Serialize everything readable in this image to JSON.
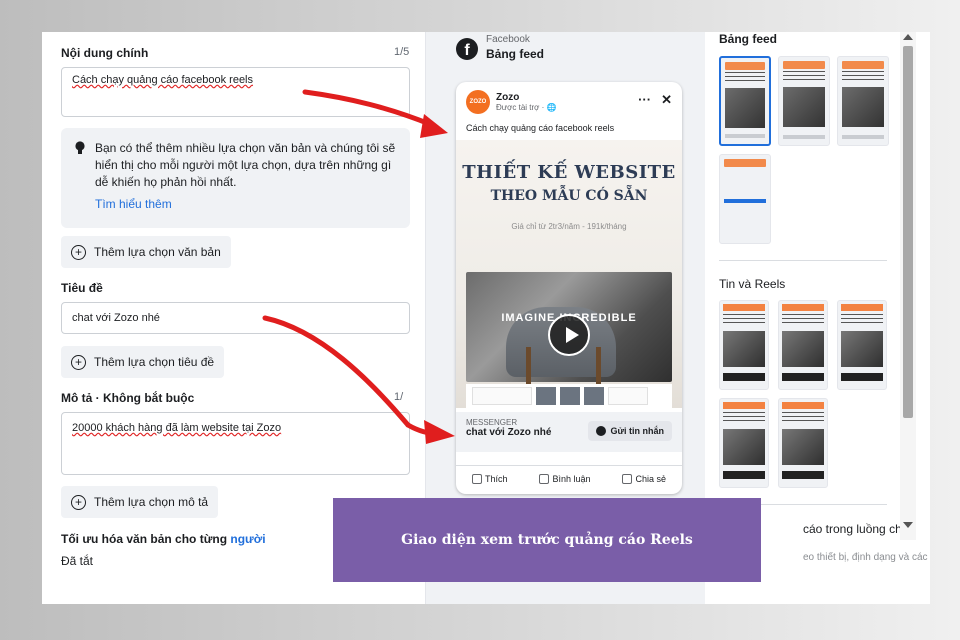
{
  "left": {
    "main_content": {
      "label": "Nội dung chính",
      "count": "1/5",
      "value": "Cách chạy quảng cáo facebook reels"
    },
    "tip": {
      "text": "Bạn có thể thêm nhiều lựa chọn văn bản và chúng tôi sẽ hiển thị cho mỗi người một lựa chọn, dựa trên những gì dễ khiến họ phản hồi nhất.",
      "link": "Tìm hiểu thêm"
    },
    "add_text_button": "Thêm lựa chọn văn bản",
    "title_section": {
      "label": "Tiêu đề",
      "value": "chat với Zozo nhé"
    },
    "add_title_button": "Thêm lựa chọn tiêu đề",
    "desc_section": {
      "label": "Mô tả · Không bắt buộc",
      "count": "1/",
      "value": "20000 khách hàng đã làm website tại Zozo"
    },
    "add_desc_button": "Thêm lựa chọn mô tả",
    "optimize": {
      "label_prefix": "Tối ưu hóa văn bản cho từng ",
      "label_highlight": "người",
      "status": "Đã tắt"
    }
  },
  "preview": {
    "platform": "Facebook",
    "placement": "Bảng feed",
    "page_name": "Zozo",
    "sponsored": "Được tài trợ · ",
    "caption": "Cách chạy quảng cáo facebook reels",
    "headline1": "THIẾT KẾ WEBSITE",
    "headline2": "THEO MẪU CÓ SẴN",
    "subline": "Giá chỉ từ 2tr3/năm - 191k/tháng",
    "imagine": "IMAGINE INCREDIBLE",
    "cta_small": "MESSENGER",
    "cta_title": "chat với Zozo nhé",
    "cta_button": "Gửi tin nhắn",
    "reactions": [
      "Thích",
      "Bình luận",
      "Chia sẻ"
    ],
    "menu_icon": "···",
    "close_icon": "✕"
  },
  "right": {
    "feed_title": "Bảng feed",
    "reels_title": "Tin và Reels",
    "bottom_text": "cáo trong luồng cho",
    "bottom_sub": "eo thiết bị, định dạng và các"
  },
  "banner": "Giao diện xem trước quảng cáo Reels",
  "colors": {
    "accent": "#216fdb",
    "banner": "#7a5ea8",
    "arrow": "#e01e1e",
    "brand_orange": "#f36f21"
  }
}
